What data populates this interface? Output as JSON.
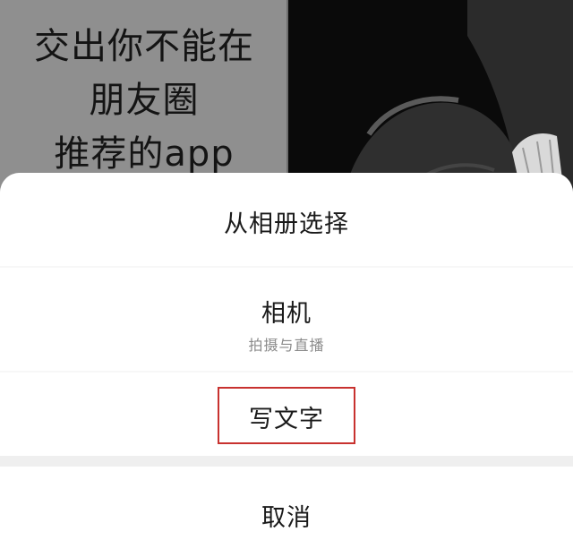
{
  "background_post": {
    "text_lines": [
      "交出你不能在",
      "朋友圈",
      "推荐的app"
    ]
  },
  "action_sheet": {
    "items": [
      {
        "label": "从相册选择"
      },
      {
        "label": "相机",
        "sublabel": "拍摄与直播"
      },
      {
        "label": "写文字"
      }
    ],
    "cancel_label": "取消"
  },
  "colors": {
    "sheet_background": "#ffffff",
    "highlight_border": "#c8322f",
    "sublabel": "#8a8a8a"
  }
}
